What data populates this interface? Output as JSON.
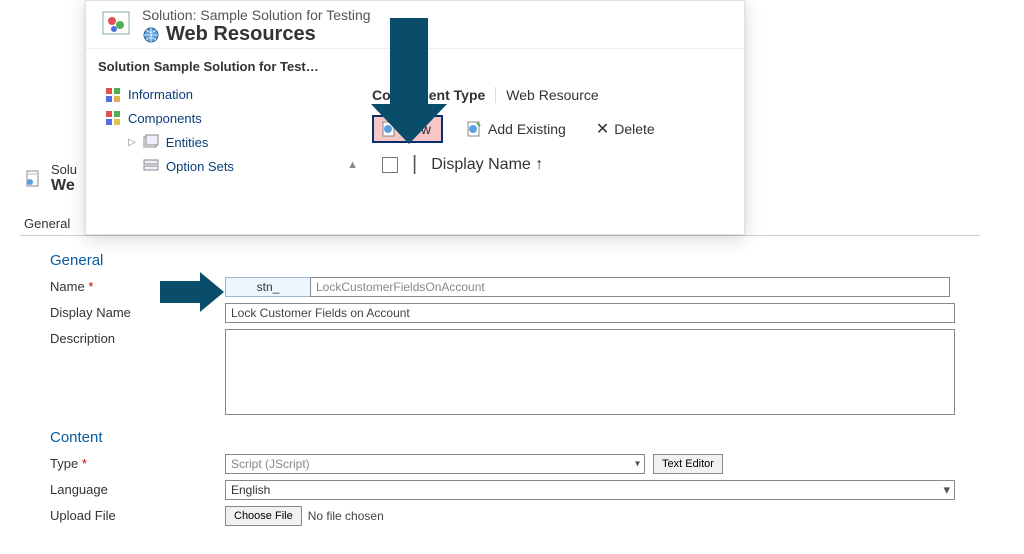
{
  "background": {
    "solution_short": "Solu",
    "wr_short": "We",
    "tab_general": "General"
  },
  "overlay": {
    "solution_line": "Solution: Sample Solution for Testing",
    "wr_title": "Web Resources",
    "tree": {
      "title": "Solution Sample Solution for Test…",
      "information": "Information",
      "components": "Components",
      "entities": "Entities",
      "option_sets": "Option Sets"
    },
    "component_type_label": "Component Type",
    "component_type_value": "Web Resource",
    "commands": {
      "new": "New",
      "add_existing": "Add Existing",
      "delete": "Delete"
    },
    "grid_header": "Display Name ↑"
  },
  "form": {
    "sections": {
      "general": "General",
      "content": "Content"
    },
    "labels": {
      "name": "Name",
      "display_name": "Display Name",
      "description": "Description",
      "type": "Type",
      "language": "Language",
      "upload_file": "Upload File"
    },
    "name_prefix": "stn_",
    "name_value": "LockCustomerFieldsOnAccount",
    "display_name_value": "Lock Customer Fields on Account",
    "type_value": "Script (JScript)",
    "type_button": "Text Editor",
    "language_value": "English",
    "file_button": "Choose File",
    "file_status": "No file chosen"
  }
}
